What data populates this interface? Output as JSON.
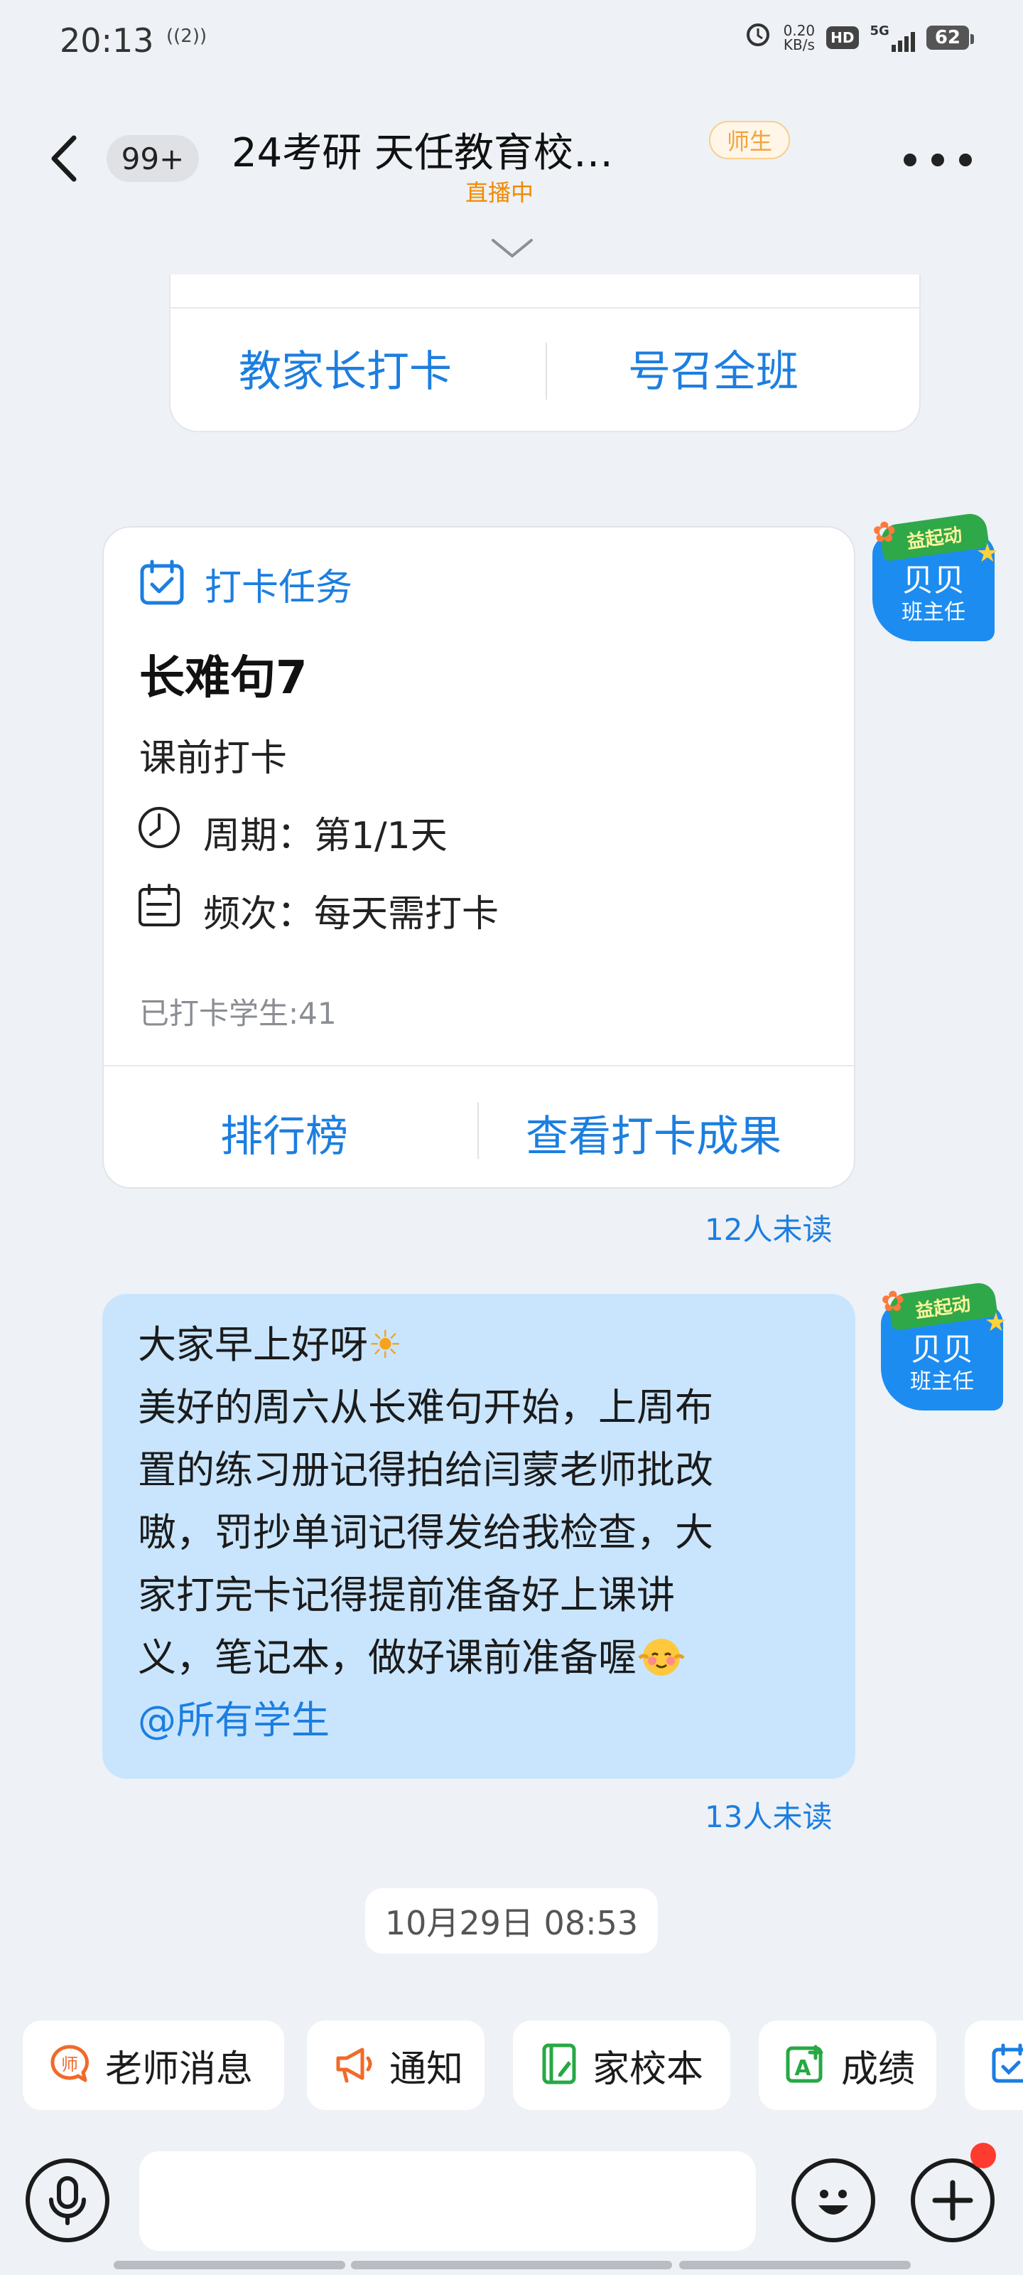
{
  "status_bar": {
    "time": "20:13",
    "signal_text": "((2))",
    "net_speed_value": "0.20",
    "net_speed_unit": "KB/s",
    "hd_label": "HD",
    "network": "5G",
    "battery": "62"
  },
  "header": {
    "unread_count": "99+",
    "title": "24考研 天任教育校…",
    "live_status": "直播中",
    "role_tag": "师生"
  },
  "top_card": {
    "left_button": "教家长打卡",
    "right_button": "号召全班"
  },
  "avatar": {
    "name": "贝贝",
    "role": "班主任",
    "decoration_text": "益起动"
  },
  "task_card": {
    "header_label": "打卡任务",
    "task_name": "长难句7",
    "subtitle": "课前打卡",
    "period_text": "周期：第1/1天",
    "frequency_text": "频次：每天需打卡",
    "checked_in_count": "已打卡学生:41",
    "left_action": "排行榜",
    "right_action": "查看打卡成果",
    "read_status": "12人未读"
  },
  "message": {
    "line1": "大家早上好呀",
    "line2": "美好的周六从长难句开始，上周布",
    "line3": "置的练习册记得拍给闫蒙老师批改",
    "line4": "嗷，罚抄单词记得发给我检查，大",
    "line5": "家打完卡记得提前准备好上课讲",
    "line6": "义，笔记本，做好课前准备喔",
    "mention": "@所有学生",
    "read_status": "13人未读"
  },
  "timestamp": "10月29日 08:53",
  "quick_actions": [
    {
      "label": "老师消息",
      "icon": "teacher-message-icon",
      "color": "#f06a2a"
    },
    {
      "label": "通知",
      "icon": "megaphone-icon",
      "color": "#f06a2a"
    },
    {
      "label": "家校本",
      "icon": "notebook-icon",
      "color": "#27a844"
    },
    {
      "label": "成绩",
      "icon": "grade-icon",
      "color": "#27a844"
    },
    {
      "label": "",
      "icon": "calendar-check-icon",
      "color": "#1c7ee0"
    }
  ],
  "colors": {
    "accent_blue": "#1c7ee0",
    "live_orange": "#f08a00",
    "bubble_blue": "#c9e5fd",
    "avatar_blue": "#1d8cf0"
  }
}
